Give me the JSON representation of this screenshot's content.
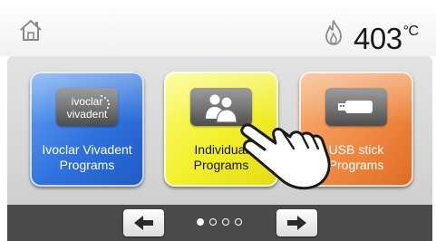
{
  "header": {
    "home_icon": "home-icon",
    "flame_icon": "flame-icon",
    "temperature_value": "403",
    "temperature_unit": "°C"
  },
  "tiles": [
    {
      "label_line1": "Ivoclar Vivadent",
      "label_line2": "Programs",
      "icon": "ivoclar-vivadent-logo",
      "color": "#2f72de"
    },
    {
      "label_line1": "Individual",
      "label_line2": "Programs",
      "icon": "users-icon",
      "color": "#f2f02a"
    },
    {
      "label_line1": "USB stick",
      "label_line2": "Programs",
      "icon": "usb-stick-icon",
      "color": "#f08a44"
    }
  ],
  "logo_text": {
    "line1": "ivoclar",
    "line2": "vivadent"
  },
  "navigation": {
    "prev_icon": "arrow-left-icon",
    "next_icon": "arrow-right-icon",
    "page_count": 4,
    "active_page": 1
  },
  "overlay": {
    "icon": "pointing-hand-icon"
  }
}
